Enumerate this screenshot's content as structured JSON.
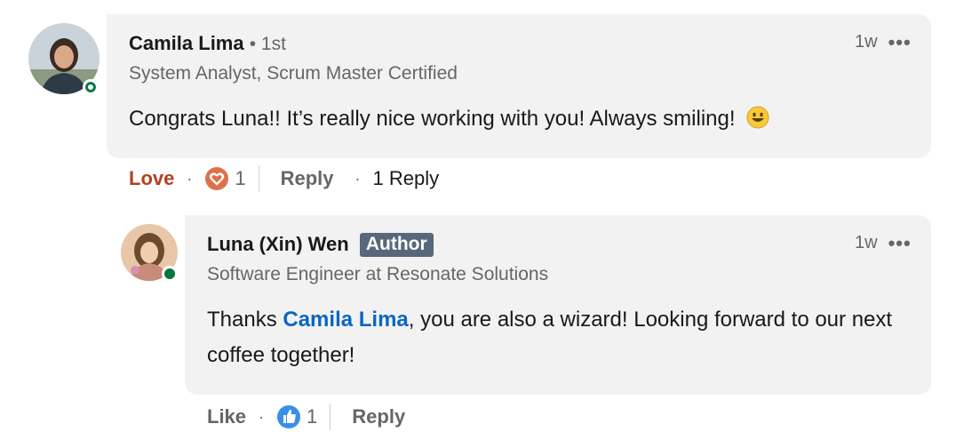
{
  "comment": {
    "author": "Camila Lima",
    "degree": "• 1st",
    "headline": "System Analyst, Scrum Master Certified",
    "time": "1w",
    "more_icon": "•••",
    "text": "Congrats Luna!! It’s really nice working with you! Always smiling!",
    "emoji": "smiling-face-emoji",
    "actions": {
      "reaction_label": "Love",
      "reaction_icon": "love-reaction-icon",
      "reaction_count": "1",
      "reply_label": "Reply",
      "reply_count": "1 Reply"
    }
  },
  "reply": {
    "author": "Luna (Xin) Wen",
    "badge": "Author",
    "headline": "Software Engineer at Resonate Solutions",
    "time": "1w",
    "more_icon": "•••",
    "text_before": "Thanks ",
    "mention": "Camila Lima",
    "text_after": ", you are also a wizard! Looking forward to our next coffee together!",
    "actions": {
      "reaction_label": "Like",
      "reaction_icon": "like-reaction-icon",
      "reaction_count": "1",
      "reply_label": "Reply"
    }
  },
  "colors": {
    "bubble_bg": "#f2f2f2",
    "love_red": "#b24020",
    "mention_blue": "#0a66c2",
    "badge_bg": "#56687a",
    "online_green": "#057642"
  }
}
